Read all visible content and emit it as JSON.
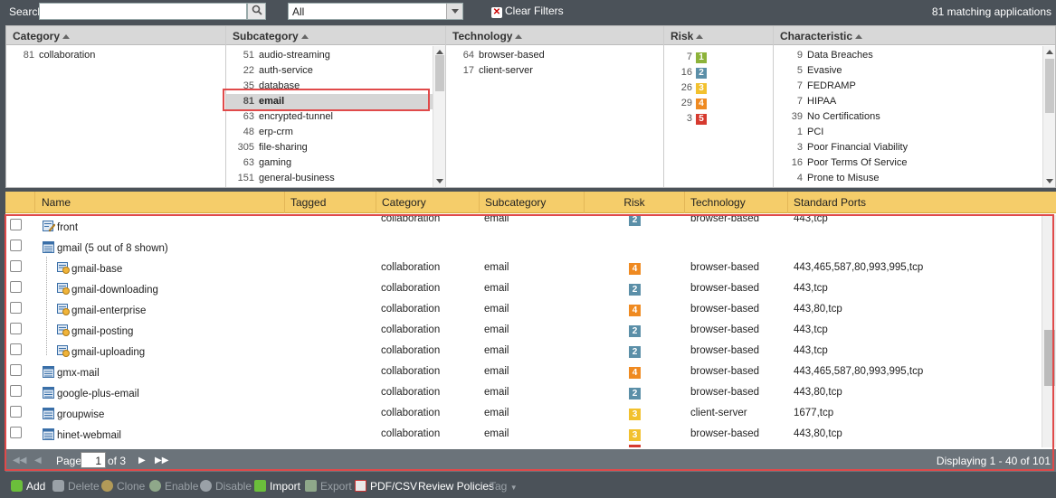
{
  "topbar": {
    "search_label": "Search",
    "search_value": "",
    "filter_value": "All",
    "clear_filters": "Clear Filters",
    "matching": "81 matching applications"
  },
  "facets": {
    "category": {
      "title": "Category",
      "items": [
        {
          "count": "81",
          "name": "collaboration"
        }
      ]
    },
    "subcategory": {
      "title": "Subcategory",
      "items": [
        {
          "count": "51",
          "name": "audio-streaming"
        },
        {
          "count": "22",
          "name": "auth-service"
        },
        {
          "count": "35",
          "name": "database"
        },
        {
          "count": "81",
          "name": "email",
          "selected": true
        },
        {
          "count": "63",
          "name": "encrypted-tunnel"
        },
        {
          "count": "48",
          "name": "erp-crm"
        },
        {
          "count": "305",
          "name": "file-sharing"
        },
        {
          "count": "63",
          "name": "gaming"
        },
        {
          "count": "151",
          "name": "general-business"
        }
      ]
    },
    "technology": {
      "title": "Technology",
      "items": [
        {
          "count": "64",
          "name": "browser-based"
        },
        {
          "count": "17",
          "name": "client-server"
        }
      ]
    },
    "risk": {
      "title": "Risk",
      "items": [
        {
          "count": "7",
          "level": "1",
          "color": "#8db33a"
        },
        {
          "count": "16",
          "level": "2",
          "color": "#5b8fa8"
        },
        {
          "count": "26",
          "level": "3",
          "color": "#f2c12e"
        },
        {
          "count": "29",
          "level": "4",
          "color": "#ef8a21"
        },
        {
          "count": "3",
          "level": "5",
          "color": "#d63a2f"
        }
      ]
    },
    "characteristic": {
      "title": "Characteristic",
      "items": [
        {
          "count": "9",
          "name": "Data Breaches"
        },
        {
          "count": "5",
          "name": "Evasive"
        },
        {
          "count": "7",
          "name": "FEDRAMP"
        },
        {
          "count": "7",
          "name": "HIPAA"
        },
        {
          "count": "39",
          "name": "No Certifications"
        },
        {
          "count": "1",
          "name": "PCI"
        },
        {
          "count": "3",
          "name": "Poor Financial Viability"
        },
        {
          "count": "16",
          "name": "Poor Terms Of Service"
        },
        {
          "count": "4",
          "name": "Prone to Misuse"
        }
      ]
    }
  },
  "grid": {
    "columns": [
      "Name",
      "Tagged",
      "Category",
      "Subcategory",
      "Risk",
      "Technology",
      "Standard Ports"
    ],
    "rows": [
      {
        "name": "front",
        "kind": "app-edit",
        "indent": 0,
        "category": "collaboration",
        "subcategory": "email",
        "risk": "2",
        "risk_color": "#5b8fa8",
        "technology": "browser-based",
        "ports": "443,tcp"
      },
      {
        "name": "gmail (5 out of 8 shown)",
        "kind": "group",
        "indent": 0,
        "category": "",
        "subcategory": "",
        "risk": "",
        "risk_color": "",
        "technology": "",
        "ports": ""
      },
      {
        "name": "gmail-base",
        "kind": "sub",
        "indent": 1,
        "category": "collaboration",
        "subcategory": "email",
        "risk": "4",
        "risk_color": "#ef8a21",
        "technology": "browser-based",
        "ports": "443,465,587,80,993,995,tcp"
      },
      {
        "name": "gmail-downloading",
        "kind": "sub",
        "indent": 1,
        "category": "collaboration",
        "subcategory": "email",
        "risk": "2",
        "risk_color": "#5b8fa8",
        "technology": "browser-based",
        "ports": "443,tcp"
      },
      {
        "name": "gmail-enterprise",
        "kind": "sub",
        "indent": 1,
        "category": "collaboration",
        "subcategory": "email",
        "risk": "4",
        "risk_color": "#ef8a21",
        "technology": "browser-based",
        "ports": "443,80,tcp"
      },
      {
        "name": "gmail-posting",
        "kind": "sub",
        "indent": 1,
        "category": "collaboration",
        "subcategory": "email",
        "risk": "2",
        "risk_color": "#5b8fa8",
        "technology": "browser-based",
        "ports": "443,tcp"
      },
      {
        "name": "gmail-uploading",
        "kind": "sub",
        "indent": 1,
        "category": "collaboration",
        "subcategory": "email",
        "risk": "2",
        "risk_color": "#5b8fa8",
        "technology": "browser-based",
        "ports": "443,tcp"
      },
      {
        "name": "gmx-mail",
        "kind": "app",
        "indent": 0,
        "category": "collaboration",
        "subcategory": "email",
        "risk": "4",
        "risk_color": "#ef8a21",
        "technology": "browser-based",
        "ports": "443,465,587,80,993,995,tcp"
      },
      {
        "name": "google-plus-email",
        "kind": "app",
        "indent": 0,
        "category": "collaboration",
        "subcategory": "email",
        "risk": "2",
        "risk_color": "#5b8fa8",
        "technology": "browser-based",
        "ports": "443,80,tcp"
      },
      {
        "name": "groupwise",
        "kind": "app",
        "indent": 0,
        "category": "collaboration",
        "subcategory": "email",
        "risk": "3",
        "risk_color": "#f2c12e",
        "technology": "client-server",
        "ports": "1677,tcp"
      },
      {
        "name": "hinet-webmail",
        "kind": "app",
        "indent": 0,
        "category": "collaboration",
        "subcategory": "email",
        "risk": "3",
        "risk_color": "#f2c12e",
        "technology": "browser-based",
        "ports": "443,80,tcp"
      }
    ]
  },
  "pager": {
    "page_label": "Page",
    "page_value": "1",
    "of_label": "of 3",
    "displaying": "Displaying 1 - 40 of 101"
  },
  "toolbar": {
    "add": "Add",
    "delete": "Delete",
    "clone": "Clone",
    "enable": "Enable",
    "disable": "Disable",
    "import": "Import",
    "export": "Export",
    "pdfcsv": "PDF/CSV",
    "review": "Review Policies",
    "tag": "Tag"
  }
}
